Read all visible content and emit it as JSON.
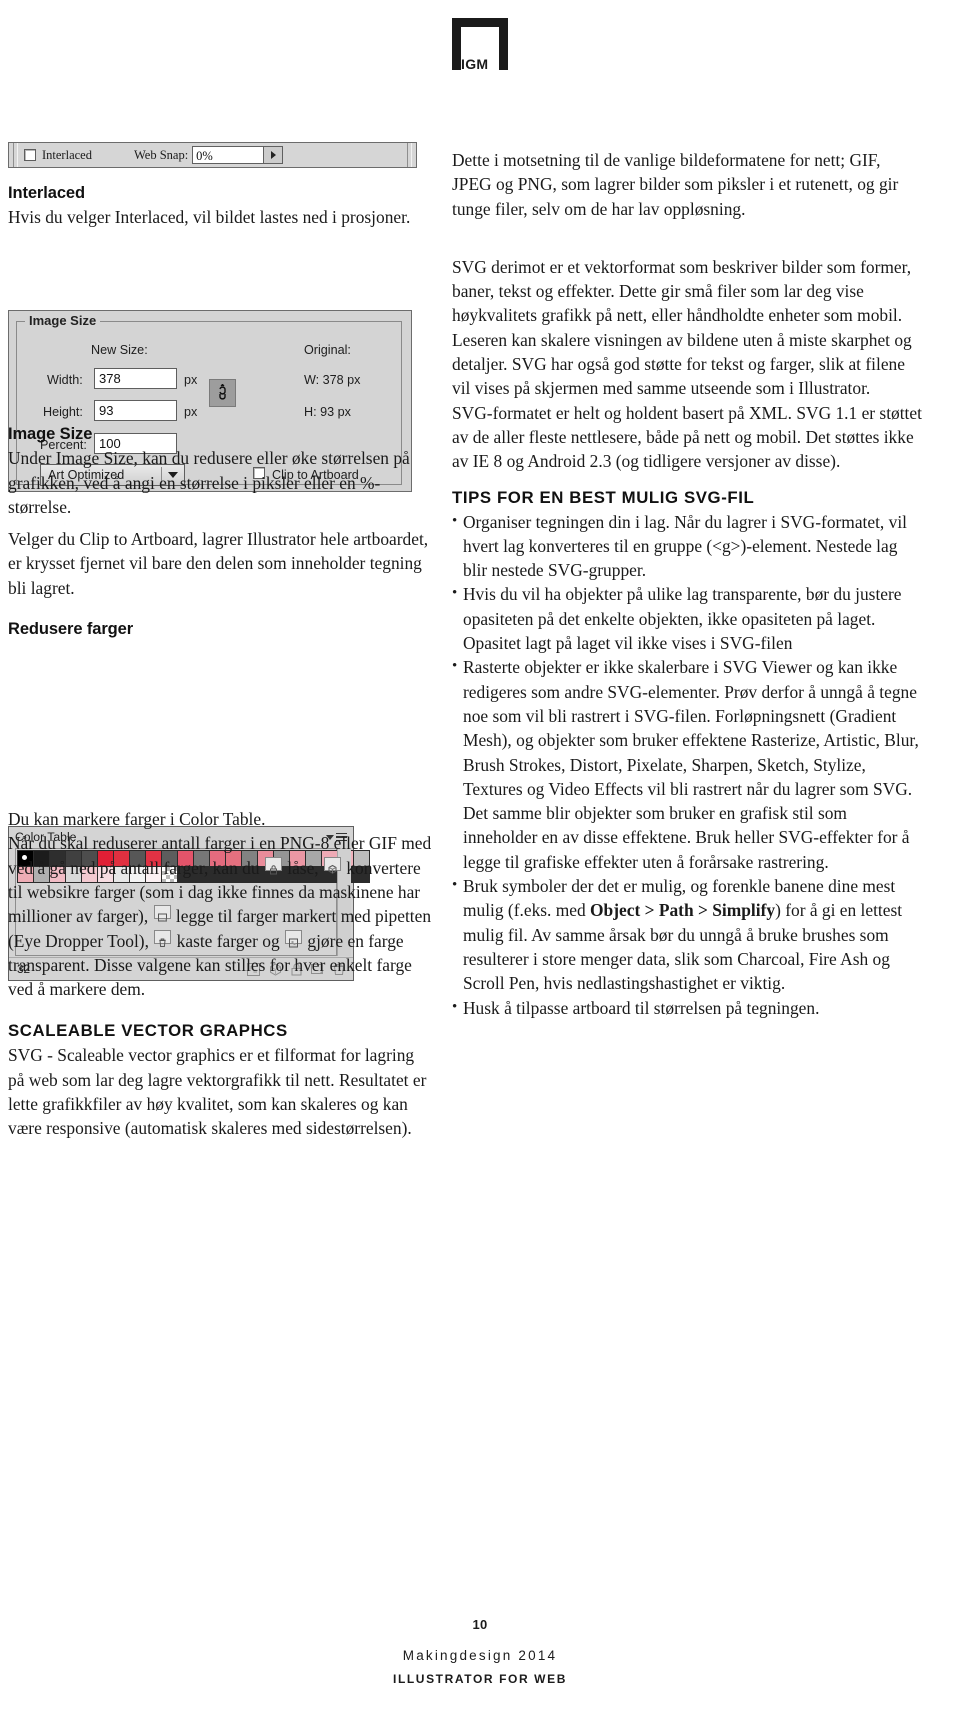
{
  "logo": {
    "text": "IGM"
  },
  "interlaced_panel": {
    "checkbox_label": "Interlaced",
    "websnap_label": "Web Snap:",
    "websnap_value": "0%",
    "arrow_icon": "triangle-right-icon"
  },
  "image_size_panel": {
    "group_title": "Image Size",
    "new_size_label": "New Size:",
    "original_label": "Original:",
    "width_label": "Width:",
    "width_value": "378",
    "width_unit": "px",
    "height_label": "Height:",
    "height_value": "93",
    "height_unit": "px",
    "percent_label": "Percent:",
    "percent_value": "100",
    "original_w": "W:  378 px",
    "original_h": "H:  93 px",
    "quality_select": "Art Optimized",
    "clip_label": "Clip to Artboard",
    "link_icon": "chain-link-icon"
  },
  "color_table_panel": {
    "title": "Color Table",
    "menu_icon": "panel-menu-icon",
    "count": "32",
    "footer_icons": [
      "transparency-icon",
      "web-shift-icon",
      "lock-icon",
      "new-color-icon",
      "trash-icon"
    ],
    "swatches_row1": [
      "#000000",
      "#1c1c1c",
      "#2e2e2e",
      "#404040",
      "#4d4d4d",
      "#e11f35",
      "#e03040",
      "#575757",
      "#e23244",
      "#5d5d5d",
      "#e3546a",
      "#777777",
      "#e46b7e",
      "#e4707f",
      "#828282",
      "#e98c9a",
      "#969696",
      "#eb97a4",
      "#a8a8a8",
      "#eeaab5",
      "#f0b3bd",
      "#bdbdbd"
    ],
    "swatches_row2": [
      "#eeacb5",
      "#b0b0b0",
      "#f1bcc5",
      "#d8d8d8",
      "#f3c9d0",
      "#f7dde2",
      "#e7e7e7",
      "#f4f4f4",
      "#fbf0f2",
      "checker"
    ]
  },
  "left_column": {
    "heading_interlaced": "Interlaced",
    "p_interlaced": "Hvis du velger Interlaced, vil bildet lastes ned i prosjoner.",
    "heading_image_size": "Image Size",
    "p_image_size_1": "Under Image Size, kan du redusere eller øke størrelsen på grafikken, ved å angi en størrelse i piksler eller en %-størrelse.",
    "p_image_size_2": "Velger du Clip to Artboard, lagrer Illustrator hele artboardet, er krysset fjernet vil bare den delen som inneholder tegning bli lagret.",
    "heading_redusere": "Redusere farger",
    "p_colortable_1": "Du kan markere farger i Color Table.",
    "p_colortable_2a": "Når du skal reduserer antall farger i en PNG-8 eller GIF med ved å gå ned på antall farger, kan du",
    "p_colortable_2b": "låse,",
    "p_colortable_2c": "konvertere til websikre farger (som i dag ikke finnes da maskinene har millioner av farger),",
    "p_colortable_2d": "legge til farger markert med pipetten (Eye Dropper Tool),",
    "p_colortable_2e": "kaste farger og",
    "p_colortable_2f": "gjøre en farge transparent. Disse valgene kan stilles for hver enkelt farge ved å markere dem.",
    "heading_svg": "SCALEABLE VECTOR GRAPHCS",
    "p_svg": "SVG - Scaleable vector graphics er et filformat for lagring på web som lar deg lagre vektorgrafikk til nett. Resultatet er lette grafikkfiler av høy kvalitet, som kan skaleres og kan være responsive (automatisk skaleres med sidestørrelsen)."
  },
  "right_column": {
    "p_1": "Dette i motsetning til de vanlige bildeformatene for nett; GIF, JPEG og PNG, som lagrer bilder som piksler i et rutenett, og gir tunge filer, selv om de har lav oppløsning.",
    "p_2": "SVG derimot er et vektorformat som beskriver bilder som former, baner, tekst og effekter. Dette gir små filer som lar deg vise høykvalitets grafikk på nett, eller håndholdte enheter som mobil. Leseren kan skalere visningen av bildene uten å miste skarphet og detaljer. SVG har også god støtte for tekst og farger, slik at filene vil vises på skjermen med samme utseende som i Illustrator.",
    "p_3": "SVG-formatet er helt og holdent basert på XML. SVG 1.1 er støttet av de aller fleste nettlesere, både på nett og mobil. Det støttes ikke av IE 8 og Android 2.3 (og tidligere versjoner av disse).",
    "heading_tips": "TIPS FOR EN BEST MULIG SVG-FIL",
    "bullets": [
      "Organiser tegningen din i lag. Når du lagrer i SVG-formatet, vil hvert lag konverteres til en gruppe (<g>)-element. Nestede lag blir nestede SVG-grupper.",
      "Hvis du vil ha objekter på ulike lag transparente, bør du justere opasiteten på det enkelte objekten, ikke opasiteten på laget. Opasitet lagt på laget vil ikke vises i SVG-filen"
    ],
    "bullet_3_part1": "Rasterte objekter er ikke skalerbare i SVG Viewer og kan ikke redigeres som andre SVG-elementer. Prøv derfor å unngå å tegne noe som vil bli rastrert i SVG-filen. Forløpningsnett (Gradient Mesh), og objekter som bruker effektene Rasterize, Artistic, Blur, Brush Strokes, Distort, Pixelate, Sharpen, Sketch, Stylize, Textures og Video Effects vil bli rastrert når du lagrer som SVG. Det samme blir objekter som bruker en grafisk stil som inneholder en av disse effektene. Bruk heller SVG-effekter for å legge til grafiske effekter uten å forårsake rastrering.",
    "bullet_4_pre": "Bruk symboler der det er mulig, og forenkle banene dine mest mulig (f.eks. med ",
    "bullet_4_bold1": "Object > Path >",
    "bullet_4_bold2": "Simplify",
    "bullet_4_post": ") for å gi en lettest mulig fil.",
    "bullet_4_tail": "Av samme årsak bør du unngå å bruke brushes som resulterer i store menger data, slik som Charcoal, Fire Ash og Scroll Pen, hvis nedlastingshastighet er viktig.",
    "bullet_5": "Husk å tilpasse artboard til størrelsen på tegningen."
  },
  "footer": {
    "page_number": "10",
    "title": "Makingdesign 2014",
    "subtitle": "ILLUSTRATOR FOR WEB"
  }
}
